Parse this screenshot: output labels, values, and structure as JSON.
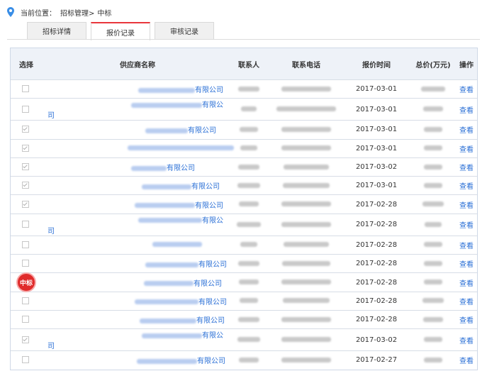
{
  "breadcrumb": {
    "prefix": "当前位置：",
    "path": "招标管理>",
    "current": "中标"
  },
  "tabs": [
    {
      "label": "招标详情",
      "active": false
    },
    {
      "label": "报价记录",
      "active": true
    },
    {
      "label": "审核记录",
      "active": false
    }
  ],
  "table": {
    "headers": {
      "select": "选择",
      "supplier": "供应商名称",
      "contact": "联系人",
      "phone": "联系电话",
      "time": "报价时间",
      "total": "总价(万元)",
      "action": "操作"
    },
    "action_label": "查看",
    "winner_badge": "中标",
    "rows": [
      {
        "checked": false,
        "winner": false,
        "supplier_suffix": "有限公司",
        "time": "2017-03-01"
      },
      {
        "checked": false,
        "winner": false,
        "supplier_suffix": "有限公司",
        "time": "2017-03-01"
      },
      {
        "checked": true,
        "winner": false,
        "supplier_suffix": "有限公司",
        "time": "2017-03-01"
      },
      {
        "checked": true,
        "winner": false,
        "supplier_suffix": "",
        "time": "2017-03-01"
      },
      {
        "checked": true,
        "winner": false,
        "supplier_suffix": "有限公司",
        "time": "2017-03-02"
      },
      {
        "checked": true,
        "winner": false,
        "supplier_suffix": "有限公司",
        "time": "2017-03-01"
      },
      {
        "checked": true,
        "winner": false,
        "supplier_suffix": "有限公司",
        "time": "2017-02-28"
      },
      {
        "checked": false,
        "winner": false,
        "supplier_suffix": "有限公司",
        "time": "2017-02-28"
      },
      {
        "checked": false,
        "winner": false,
        "supplier_suffix": "",
        "time": "2017-02-28"
      },
      {
        "checked": false,
        "winner": false,
        "supplier_suffix": "有限公司",
        "time": "2017-02-28"
      },
      {
        "checked": false,
        "winner": true,
        "supplier_suffix": "有限公司",
        "time": "2017-02-28"
      },
      {
        "checked": false,
        "winner": false,
        "supplier_suffix": "有限公司",
        "time": "2017-02-28"
      },
      {
        "checked": false,
        "winner": false,
        "supplier_suffix": "有限公司",
        "time": "2017-02-28"
      },
      {
        "checked": true,
        "winner": false,
        "supplier_suffix": "有限公司",
        "time": "2017-03-02"
      },
      {
        "checked": false,
        "winner": false,
        "supplier_suffix": "有限公司",
        "time": "2017-02-27"
      }
    ]
  },
  "colors": {
    "accent_red": "#e8363c",
    "link_blue": "#2a6fd6",
    "header_bg": "#eef2f8",
    "badge_red": "#e02b2b"
  },
  "icons": {
    "location": "location-pin-icon"
  }
}
